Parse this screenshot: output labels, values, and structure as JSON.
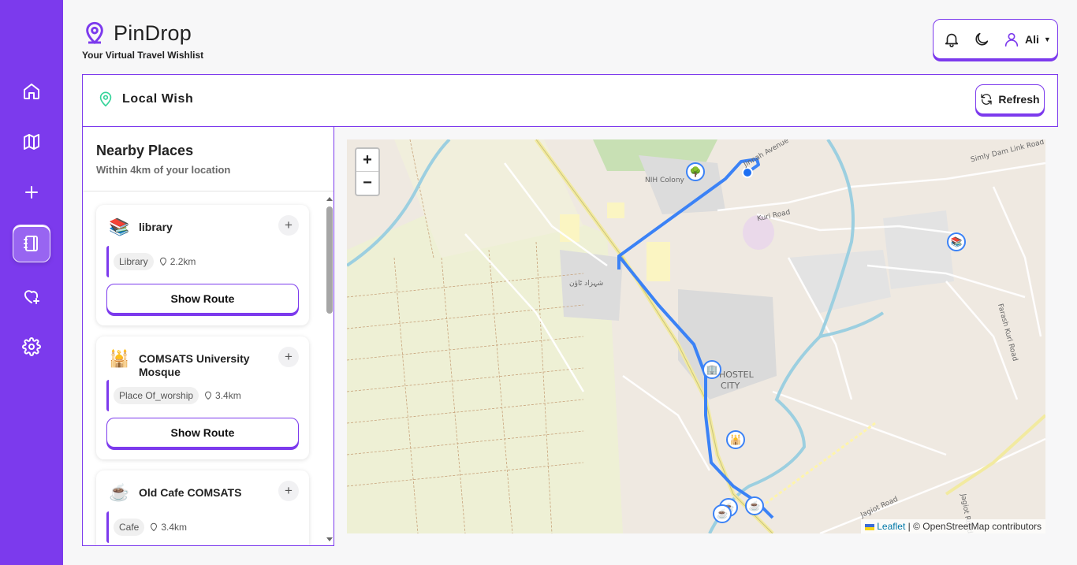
{
  "app": {
    "title": "PinDrop",
    "subtitle": "Your Virtual Travel Wishlist"
  },
  "sidebar": {
    "items": [
      {
        "name": "home",
        "icon": "home-icon"
      },
      {
        "name": "map",
        "icon": "map-icon"
      },
      {
        "name": "add",
        "icon": "plus-icon"
      },
      {
        "name": "notebook",
        "icon": "notebook-icon",
        "active": true
      },
      {
        "name": "wishlist",
        "icon": "heart-plus-icon"
      },
      {
        "name": "settings",
        "icon": "gear-icon"
      }
    ]
  },
  "header": {
    "user": "Ali"
  },
  "panel": {
    "title": "Local Wish",
    "refresh_label": "Refresh"
  },
  "nearby": {
    "title": "Nearby Places",
    "subtitle": "Within 4km of your location",
    "places": [
      {
        "name": "library",
        "category": "Library",
        "distance": "2.2km",
        "icon": "📚",
        "route_label": "Show Route"
      },
      {
        "name": "COMSATS University Mosque",
        "category": "Place Of_worship",
        "distance": "3.4km",
        "icon": "🕌",
        "route_label": "Show Route"
      },
      {
        "name": "Old Cafe COMSATS",
        "category": "Cafe",
        "distance": "3.4km",
        "icon": "☕"
      }
    ]
  },
  "map": {
    "zoom_in": "+",
    "zoom_out": "−",
    "attribution_leaflet": "Leaflet",
    "attribution_rest": "| © OpenStreetMap contributors",
    "labels": {
      "nih": "NIH Colony",
      "kuri": "Kuri Road",
      "simly": "Simly Dam Link Road",
      "hostel1": "HOSTEL",
      "hostel2": "CITY",
      "farash": "Farash Kuri Road",
      "jagiot": "Jagiot Road",
      "jagiot2": "Jagiot Road",
      "avenue": "Jinnah Avenue",
      "urdu": "شہزاد ٹاؤن"
    }
  }
}
